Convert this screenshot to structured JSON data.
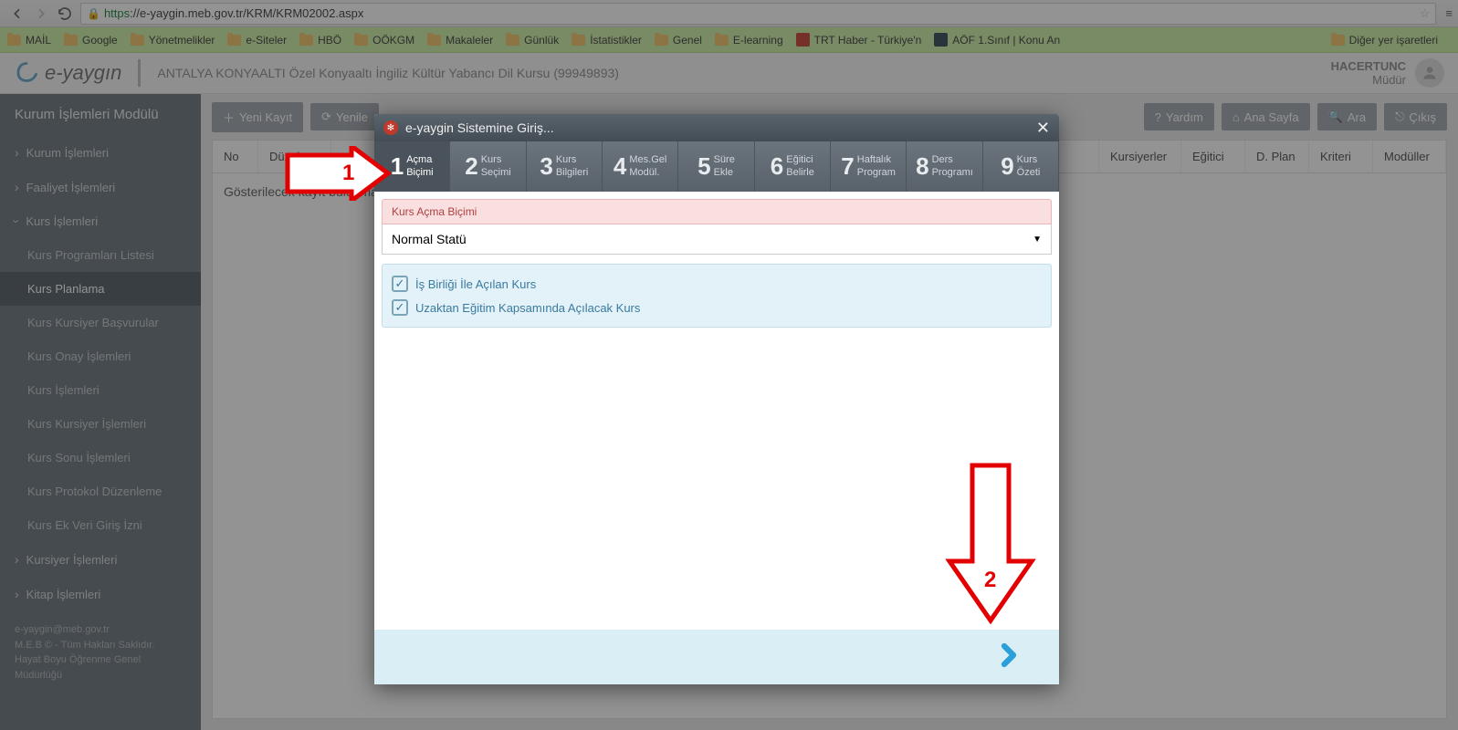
{
  "browser": {
    "url_scheme": "https",
    "url_rest": "://e-yaygin.meb.gov.tr/KRM/KRM02002.aspx"
  },
  "bookmarks": {
    "items": [
      "MAİL",
      "Google",
      "Yönetmelikler",
      "e-Siteler",
      "HBÖ",
      "OÖKGM",
      "Makaleler",
      "Günlük",
      "İstatistikler",
      "Genel",
      "E-learning"
    ],
    "trt": "TRT Haber - Türkiye'n",
    "aof": "AÖF 1.Sınıf | Konu An",
    "other": "Diğer yer işaretleri"
  },
  "header": {
    "logo_text": "e-yaygın",
    "org": "ANTALYA KONYAALTI Özel Konyaaltı İngiliz Kültür Yabancı Dil Kursu (99949893)",
    "user_name": "HACERTUNC",
    "user_role": "Müdür"
  },
  "sidebar": {
    "module_title": "Kurum İşlemleri Modülü",
    "kurum": "Kurum İşlemleri",
    "faaliyet": "Faaliyet İşlemleri",
    "kurs": "Kurs İşlemleri",
    "subs": {
      "programlari": "Kurs Programları Listesi",
      "planlama": "Kurs Planlama",
      "basvuru": "Kurs Kursiyer Başvurular",
      "onay": "Kurs Onay İşlemleri",
      "kursisl": "Kurs İşlemleri",
      "kursiyerisl": "Kurs Kursiyer İşlemleri",
      "sonu": "Kurs Sonu İşlemleri",
      "protokol": "Kurs Protokol Düzenleme",
      "ekveri": "Kurs Ek Veri Giriş İzni"
    },
    "kursiyer": "Kursiyer İşlemleri",
    "kitap": "Kitap İşlemleri",
    "footer1": "e-yaygin@meb.gov.tr",
    "footer2": "M.E.B © - Tüm Hakları Saklıdır.",
    "footer3": "Hayat Boyu Öğrenme Genel Müdürlüğü"
  },
  "toolbar": {
    "yeni": "Yeni Kayıt",
    "yenile": "Yenile",
    "yardim": "Yardım",
    "anasayfa": "Ana Sayfa",
    "ara": "Ara",
    "cikis": "Çıkış"
  },
  "table": {
    "cols": {
      "no": "No",
      "duzelt": "Düzelt",
      "kursiyerler": "Kursiyerler",
      "egitici": "Eğitici",
      "dplan": "D. Plan",
      "kriteri": "Kriteri",
      "moduller": "Modüller"
    },
    "empty": "Gösterilecek kayıt bulunmam"
  },
  "modal": {
    "title": "e-yaygin Sistemine Giriş...",
    "steps": [
      {
        "n": "1",
        "l1": "Açma",
        "l2": "Biçimi"
      },
      {
        "n": "2",
        "l1": "Kurs",
        "l2": "Seçimi"
      },
      {
        "n": "3",
        "l1": "Kurs",
        "l2": "Bilgileri"
      },
      {
        "n": "4",
        "l1": "Mes.Gel",
        "l2": "Modül."
      },
      {
        "n": "5",
        "l1": "Süre",
        "l2": "Ekle"
      },
      {
        "n": "6",
        "l1": "Eğitici",
        "l2": "Belirle"
      },
      {
        "n": "7",
        "l1": "Haftalık",
        "l2": "Program"
      },
      {
        "n": "8",
        "l1": "Ders",
        "l2": "Programı"
      },
      {
        "n": "9",
        "l1": "Kurs",
        "l2": "Özeti"
      }
    ],
    "section_label": "Kurs Açma Biçimi",
    "select_value": "Normal Statü",
    "chk1": "İş Birliği İle Açılan Kurs",
    "chk2": "Uzaktan Eğitim Kapsamında Açılacak Kurs"
  },
  "anno": {
    "one": "1",
    "two": "2"
  }
}
